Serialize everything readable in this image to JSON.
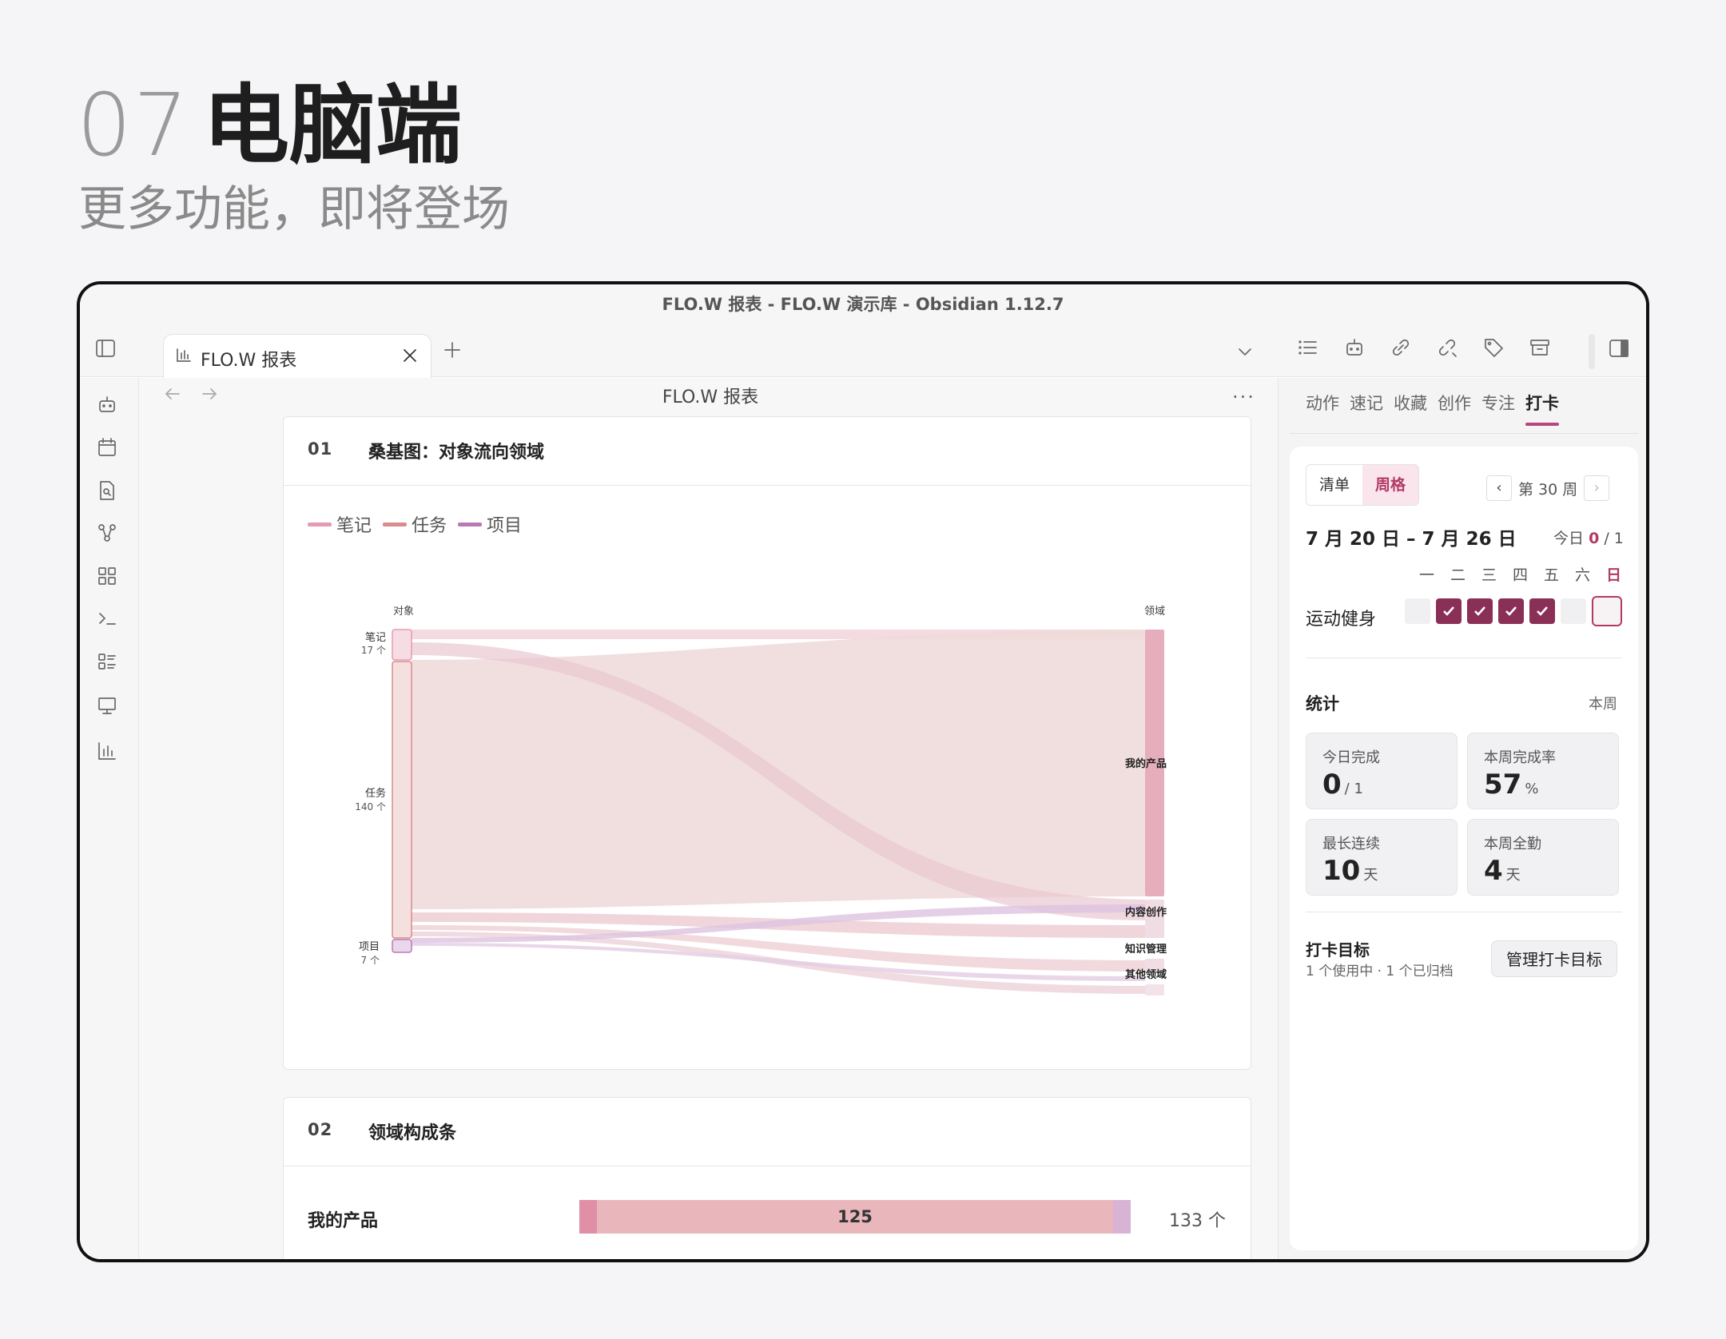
{
  "hero": {
    "number": "07",
    "title": "电脑端",
    "subtitle": "更多功能，即将登场"
  },
  "window": {
    "title": "FLO.W 报表 - FLO.W 演示库 - Obsidian 1.12.7"
  },
  "tabs": [
    {
      "label": "FLO.W 报表",
      "icon": "chart-icon"
    }
  ],
  "ribbon_right_icons": [
    "list-icon",
    "robot-icon",
    "link-icon",
    "unlink-icon",
    "tag-icon",
    "archive-icon"
  ],
  "left_rail_icons": [
    "robot-icon",
    "calendar-icon",
    "file-search-icon",
    "graph-icon",
    "dashboard-icon",
    "terminal-icon",
    "list-view-icon",
    "presentation-icon",
    "bar-chart-icon"
  ],
  "document": {
    "title": "FLO.W 报表",
    "more": "···"
  },
  "sankey_card": {
    "number": "01",
    "title": "桑基图：对象流向领域",
    "legend": [
      {
        "label": "笔记",
        "color": "#e59bb2"
      },
      {
        "label": "任务",
        "color": "#d98c8c"
      },
      {
        "label": "项目",
        "color": "#b77bb1"
      }
    ],
    "left_header": "对象",
    "right_header": "领域",
    "left_nodes": [
      {
        "name": "笔记",
        "count": "17 个",
        "value": 17
      },
      {
        "name": "任务",
        "count": "140 个",
        "value": 140
      },
      {
        "name": "项目",
        "count": "7 个",
        "value": 7
      }
    ],
    "right_nodes": [
      {
        "name": "我的产品"
      },
      {
        "name": "内容创作"
      },
      {
        "name": "知识管理"
      },
      {
        "name": "其他领域"
      }
    ]
  },
  "bar_card": {
    "number": "02",
    "title": "领域构成条",
    "rows": [
      {
        "label": "我的产品",
        "inner_value": "125",
        "total": "133 个",
        "segments": [
          {
            "value": 4,
            "color": "#e08fa6"
          },
          {
            "value": 125,
            "color": "#e8b6bb"
          },
          {
            "value": 4,
            "color": "#d9b3d6"
          }
        ]
      }
    ]
  },
  "right_panel": {
    "tabs": [
      "动作",
      "速记",
      "收藏",
      "创作",
      "专注",
      "打卡"
    ],
    "active_tab": "打卡",
    "view_toggle": [
      "清单",
      "周格"
    ],
    "active_view": "周格",
    "week_label": "第 30 周",
    "prev": "‹",
    "next": "›",
    "date_range": "7 月 20 日 – 7 月 26 日",
    "today_label": "今日",
    "today_done": "0",
    "today_total": "/ 1",
    "weekdays": [
      "一",
      "二",
      "三",
      "四",
      "五",
      "六",
      "日"
    ],
    "habit": {
      "name": "运动健身",
      "days": [
        false,
        true,
        true,
        true,
        true,
        false,
        false
      ],
      "today_index": 6
    },
    "stats_title": "统计",
    "stats_range": "本周",
    "stats": [
      {
        "label": "今日完成",
        "value": "0",
        "unit": "/ 1"
      },
      {
        "label": "本周完成率",
        "value": "57",
        "unit": "%"
      },
      {
        "label": "最长连续",
        "value": "10",
        "unit": "天"
      },
      {
        "label": "本周全勤",
        "value": "4",
        "unit": "天"
      }
    ],
    "goal_title": "打卡目标",
    "goal_sub": "1 个使用中 · 1 个已归档",
    "goal_button": "管理打卡目标"
  }
}
